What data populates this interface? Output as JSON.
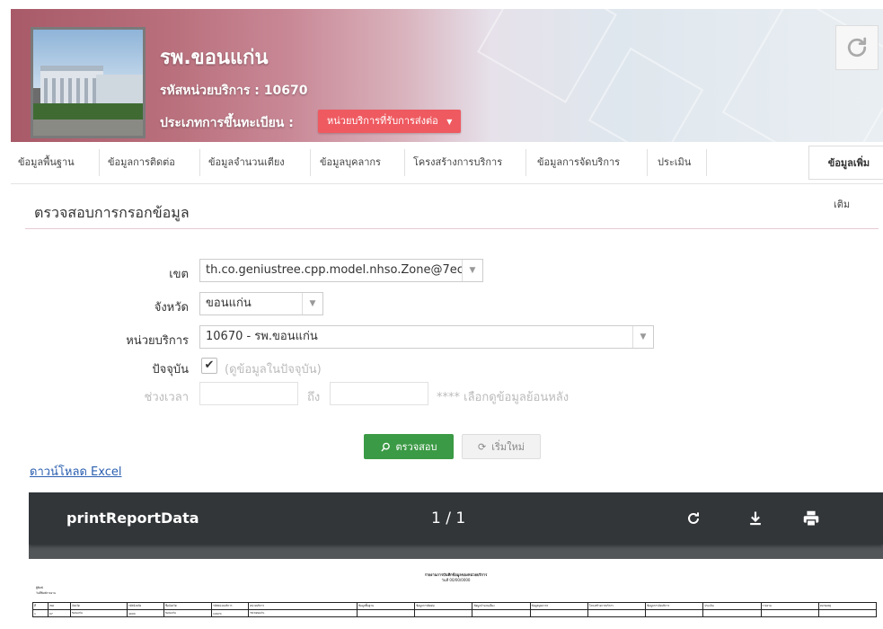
{
  "header": {
    "hospital_name": "รพ.ขอนแก่น",
    "unit_code": "รหัสหน่วยบริการ : 10670",
    "registration_type_label": "ประเภทการขึ้นทะเบียน :",
    "registration_type_value": "หน่วยบริการที่รับการส่งต่อ",
    "refresh_icon": "refresh-icon",
    "accent_color": "#ee5a60"
  },
  "nav": {
    "tabs": [
      "ข้อมูลพื้นฐาน",
      "ข้อมูลการติดต่อ",
      "ข้อมูลจำนวนเตียง",
      "ข้อมูลบุคลากร",
      "โครงสร้างการบริการ",
      "ข้อมูลการจัดบริการ",
      "ประเมิน"
    ],
    "more_line1": "ข้อมูลเพิ่ม",
    "more_line2": "เติม"
  },
  "section": {
    "title": "ตรวจสอบการกรอกข้อมูล"
  },
  "form": {
    "zone_label": "เขต",
    "zone_value": "th.co.geniustree.cpp.model.nhso.Zone@7ec",
    "province_label": "จังหวัด",
    "province_value": "ขอนแก่น",
    "unit_label": "หน่วยบริการ",
    "unit_value": "10670 - รพ.ขอนแก่น",
    "current_label": "ปัจจุบัน",
    "current_checked": "✔",
    "current_note": "(ดูข้อมูลในปัจจุบัน)",
    "period_label": "ช่วงเวลา",
    "period_to": "ถึง",
    "period_note": "**** เลือกดูข้อมูลย้อนหลัง",
    "check_button": "ตรวจสอบ",
    "reset_button": "เริ่มใหม่",
    "download_link": "ดาวน์โหลด Excel"
  },
  "pdf_viewer": {
    "title": "printReportData",
    "page_indicator": "1 / 1",
    "report_title": "รายงานการบันทึกข้อมูลของหน่วยบริการ",
    "report_subtitle": "วันที่ 00/00/0000",
    "report_meta1": "ผู้พิมพ์",
    "report_meta2": "วันที่พิมพ์รายงาน",
    "table_header": [
      "ที่",
      "เขต",
      "จังหวัด",
      "รหัสจังหวัด",
      "ชื่อจังหวัด",
      "รหัสหน่วยบริการ",
      "หน่วยบริการ",
      "ข้อมูลพื้นฐาน",
      "ข้อมูลการติดต่อ",
      "ข้อมูลจำนวนเตียง",
      "ข้อมูลบุคลากร",
      "โครงสร้างการบริการ",
      "ข้อมูลการจัดบริการ",
      "ประเมิน",
      "รายงาน",
      "หมายเหตุ"
    ],
    "table_row": [
      "1",
      "07",
      "ขอนแก่น",
      "4000",
      "ขอนแก่น",
      "10670",
      "รพ.ขอนแก่น",
      "",
      "",
      "",
      "",
      "",
      "",
      "",
      "",
      ""
    ]
  }
}
